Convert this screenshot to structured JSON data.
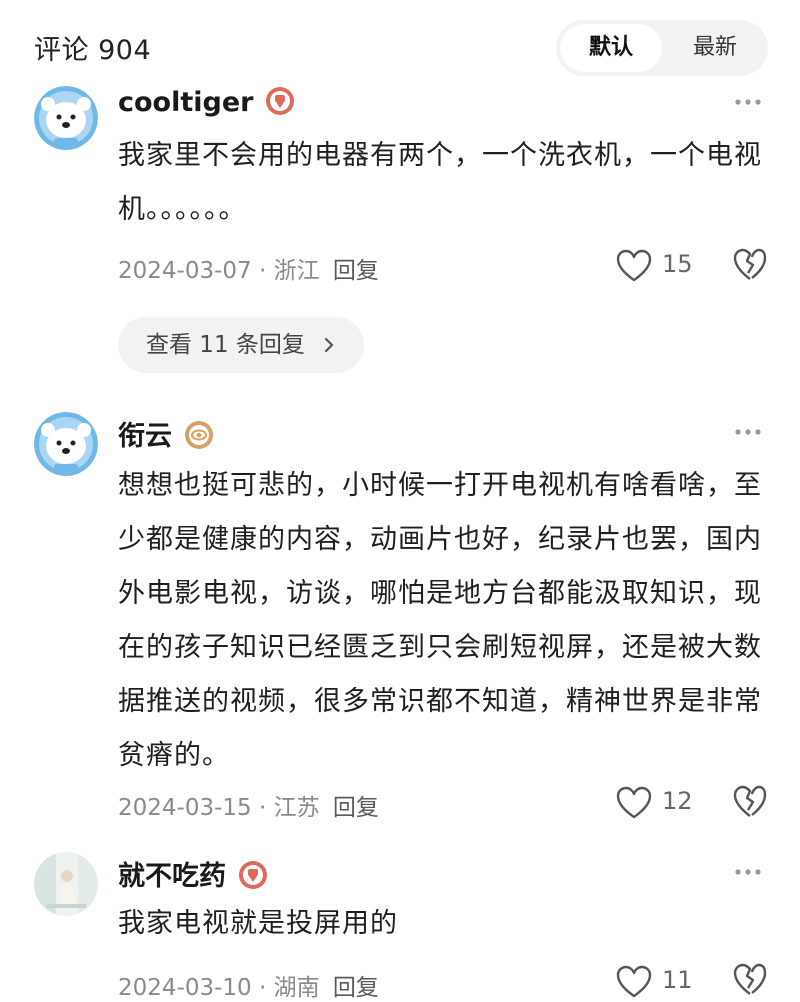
{
  "header": {
    "title": "评论 904",
    "sort_options": [
      "默认",
      "最新"
    ],
    "active_sort": "默认"
  },
  "comments": [
    {
      "author": "cooltiger",
      "badge_icon": "medal-badge-icon",
      "badge_color": "#e06a5a",
      "avatar": "bear-avatar",
      "text": "我家里不会用的电器有两个，一个洗衣机，一个电视机。。。。。。",
      "date": "2024-03-07",
      "location": "浙江",
      "reply_label": "回复",
      "likes": "15",
      "view_replies": "查看 11 条回复"
    },
    {
      "author": "衔云",
      "badge_icon": "eye-badge-icon",
      "badge_color": "#d9a066",
      "avatar": "bear-avatar",
      "text": "想想也挺可悲的，小时候一打开电视机有啥看啥，至少都是健康的内容，动画片也好，纪录片也罢，国内外电影电视，访谈，哪怕是地方台都能汲取知识，现在的孩子知识已经匮乏到只会刷短视屏，还是被大数据推送的视频，很多常识都不知道，精神世界是非常贫瘠的。",
      "date": "2024-03-15",
      "location": "江苏",
      "reply_label": "回复",
      "likes": "12"
    },
    {
      "author": "就不吃药",
      "badge_icon": "medal-badge-icon",
      "badge_color": "#e06a5a",
      "avatar": "photo-avatar",
      "text": "我家电视就是投屏用的",
      "date": "2024-03-10",
      "location": "湖南",
      "reply_label": "回复",
      "likes": "11"
    }
  ],
  "separator": "·",
  "colors": {
    "accent_blue": "#6fb8e8",
    "muted_text": "#8a8a8a",
    "pill_bg": "#f2f2f2"
  }
}
